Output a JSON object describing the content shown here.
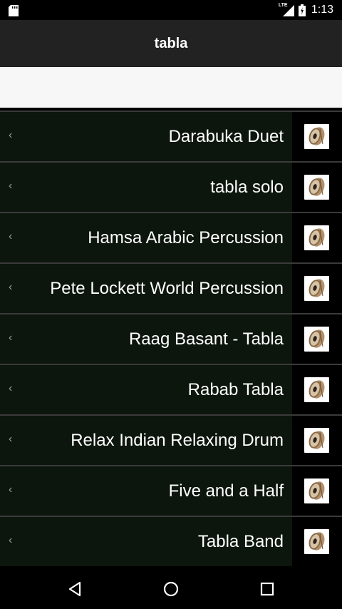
{
  "status": {
    "network": "LTE",
    "time": "1:13"
  },
  "app_bar": {
    "title": "tabla"
  },
  "search": {
    "value": ""
  },
  "items": [
    {
      "title": "Darabuka Duet",
      "icon": "tabla-drum-icon"
    },
    {
      "title": "tabla solo",
      "icon": "tabla-drum-icon"
    },
    {
      "title": "Hamsa Arabic Percussion",
      "icon": "tabla-drum-icon"
    },
    {
      "title": "Pete Lockett World Percussion",
      "icon": "tabla-drum-icon"
    },
    {
      "title": "Raag Basant - Tabla",
      "icon": "tabla-drum-icon"
    },
    {
      "title": "Rabab Tabla",
      "icon": "tabla-drum-icon"
    },
    {
      "title": "Relax Indian Relaxing Drum",
      "icon": "tabla-drum-icon"
    },
    {
      "title": "Five and a Half",
      "icon": "tabla-drum-icon"
    },
    {
      "title": "Tabla Band",
      "icon": "tabla-drum-icon"
    }
  ],
  "nav": {
    "back": "back-icon",
    "home": "home-icon",
    "recents": "recents-icon"
  },
  "colors": {
    "app_bar": "#222222",
    "row_bg": "#0d160d",
    "divider": "#3a3a3a"
  }
}
